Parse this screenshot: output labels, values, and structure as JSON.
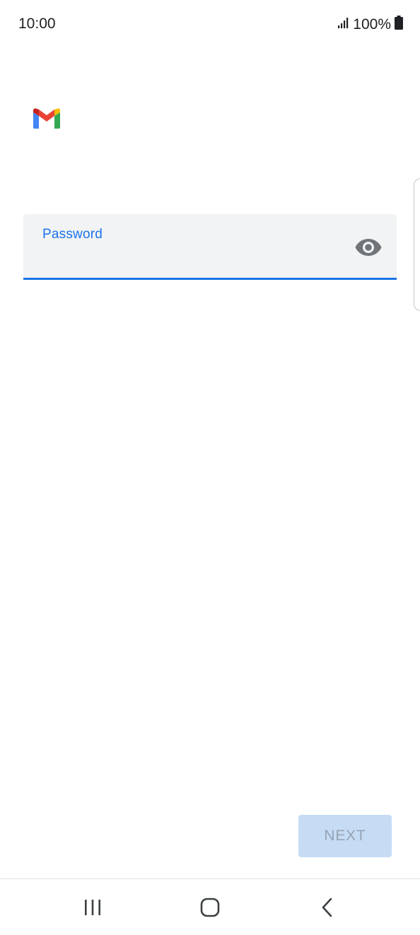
{
  "status_bar": {
    "time": "10:00",
    "battery": "100%",
    "icons": [
      "signal-icon",
      "battery-icon"
    ]
  },
  "app": {
    "logo": "gmail-logo-icon",
    "brand_colors": {
      "blue": "#4285F4",
      "red": "#EA4335",
      "yellow": "#FBBC04",
      "green": "#34A853"
    }
  },
  "password_field": {
    "label": "Password",
    "value": "",
    "toggle_icon": "eye-icon",
    "accent": "#1a73e8"
  },
  "actions": {
    "next_label": "NEXT",
    "next_enabled": false
  },
  "nav_bar": {
    "icons": [
      "recent-apps-icon",
      "home-icon",
      "back-icon"
    ]
  }
}
